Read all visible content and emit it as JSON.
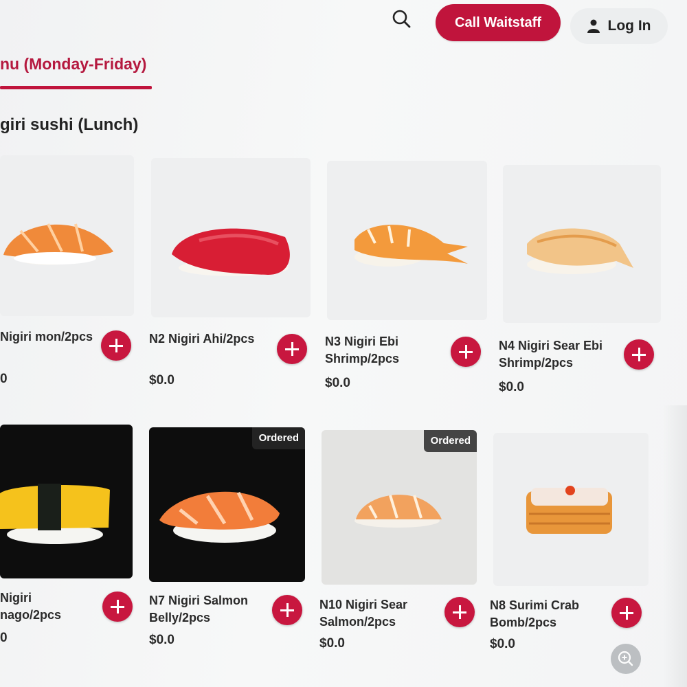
{
  "header": {
    "call_button": "Call Waitstaff",
    "login_button": "Log In"
  },
  "tab": {
    "label": "nu (Monday-Friday)"
  },
  "section": {
    "title": "giri sushi (Lunch)"
  },
  "items": [
    {
      "name": "Nigiri mon/2pcs",
      "price": "0",
      "ordered": ""
    },
    {
      "name": "N2 Nigiri Ahi/2pcs",
      "price": "$0.0",
      "ordered": ""
    },
    {
      "name": "N3 Nigiri Ebi Shrimp/2pcs",
      "price": "$0.0",
      "ordered": ""
    },
    {
      "name": "N4 Nigiri Sear Ebi Shrimp/2pcs",
      "price": "$0.0",
      "ordered": ""
    },
    {
      "name": "Nigiri nago/2pcs",
      "price": "0",
      "ordered": ""
    },
    {
      "name": "N7 Nigiri Salmon Belly/2pcs",
      "price": "$0.0",
      "ordered": "Ordered"
    },
    {
      "name": "N10 Nigiri Sear Salmon/2pcs",
      "price": "$0.0",
      "ordered": "Ordered"
    },
    {
      "name": "N8 Surimi Crab Bomb/2pcs",
      "price": "$0.0",
      "ordered": ""
    }
  ],
  "colors": {
    "accent": "#c0143c",
    "text": "#222222",
    "background": "#f3f4f5"
  },
  "icons": [
    "search-icon",
    "user-icon",
    "plus-icon",
    "zoom-in-icon"
  ]
}
